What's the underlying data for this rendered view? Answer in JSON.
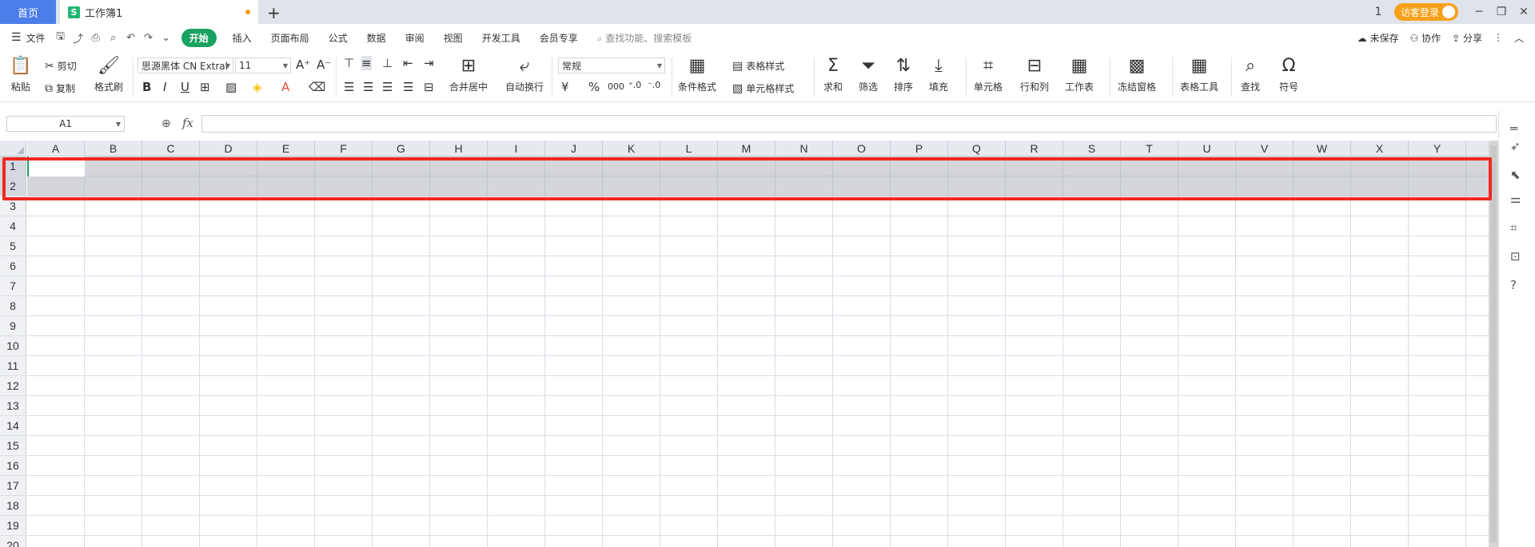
{
  "tabs": {
    "home": "首页",
    "doc_title": "工作簿1",
    "new_tab": "+"
  },
  "titlebar": {
    "login": "访客登录",
    "page_icon": "1"
  },
  "menu": {
    "file": "文件",
    "tabs": [
      "开始",
      "插入",
      "页面布局",
      "公式",
      "数据",
      "审阅",
      "视图",
      "开发工具",
      "会员专享"
    ],
    "search_placeholder": "查找功能、搜索模板",
    "unsaved": "未保存",
    "collab": "协作",
    "share": "分享"
  },
  "ribbon": {
    "paste": "粘贴",
    "cut": "剪切",
    "copy": "复制",
    "format_painter": "格式刷",
    "font_name": "思源黑体 CN Extral",
    "font_size": "11",
    "merge_center": "合并居中",
    "wrap_text": "自动换行",
    "number_format": "常规",
    "conditional_format": "条件格式",
    "table_style": "表格样式",
    "cell_style": "单元格样式",
    "sum": "求和",
    "filter": "筛选",
    "sort": "排序",
    "fill": "填充",
    "cell": "单元格",
    "rows_cols": "行和列",
    "worksheet": "工作表",
    "freeze": "冻结窗格",
    "table_tools": "表格工具",
    "find": "查找",
    "symbol": "符号"
  },
  "formula_bar": {
    "name_box": "A1",
    "fx": "fx",
    "value": ""
  },
  "sheet": {
    "columns": [
      "A",
      "B",
      "C",
      "D",
      "E",
      "F",
      "G",
      "H",
      "I",
      "J",
      "K",
      "L",
      "M",
      "N",
      "O",
      "P",
      "Q",
      "R",
      "S",
      "T",
      "U",
      "V",
      "W",
      "X",
      "Y"
    ],
    "rows": [
      "1",
      "2",
      "3",
      "4",
      "5",
      "6",
      "7",
      "8",
      "9",
      "10",
      "11",
      "12",
      "13",
      "14",
      "15",
      "16",
      "17",
      "18",
      "19",
      "20"
    ],
    "selected_rows": [
      "1",
      "2"
    ],
    "active_cell": "A1"
  },
  "colors": {
    "accent": "#1aa260",
    "highlight": "#f0281e",
    "home_tab": "#4b7ee8",
    "login": "#f7a11a"
  }
}
